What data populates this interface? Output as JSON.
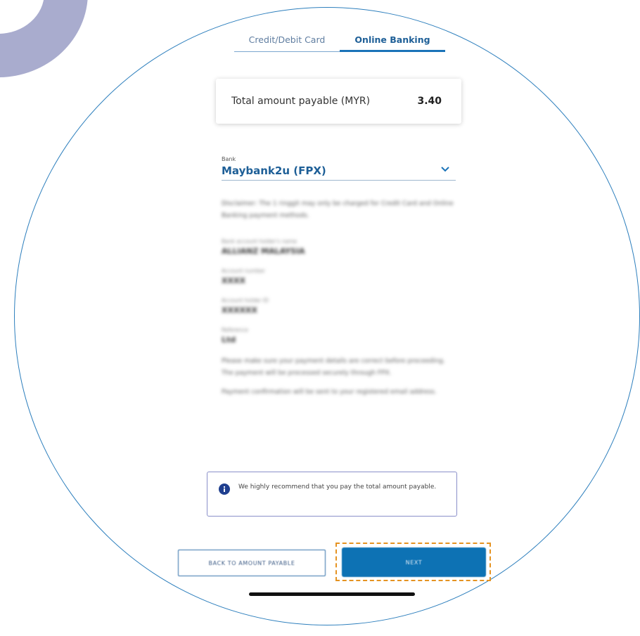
{
  "tabs": [
    {
      "label": "Credit/Debit Card",
      "active": false
    },
    {
      "label": "Online Banking",
      "active": true
    }
  ],
  "amount": {
    "label": "Total amount payable (MYR)",
    "value": "3.40"
  },
  "bank": {
    "caption": "Bank",
    "selected": "Maybank2u (FPX)"
  },
  "blurred_content": {
    "intro": "Disclaimer: The 1 ringgit may only be charged for Credit Card and Online Banking payment methods.",
    "fields": [
      {
        "label": "Bank account holder's name",
        "value": "ALLIANZ MALAYSIA"
      },
      {
        "label": "Account number",
        "value": "XXXX"
      },
      {
        "label": "Account holder ID",
        "value": "XXXXXX"
      },
      {
        "label": "Reference",
        "value": "Ltd"
      }
    ],
    "para1": "Please make sure your payment details are correct before proceeding. The payment will be processed securely through FPX.",
    "para2": "Payment confirmation will be sent to your registered email address."
  },
  "notice": {
    "icon": "info-icon",
    "text": "We highly recommend that you pay the total amount payable."
  },
  "buttons": {
    "back": "BACK TO AMOUNT PAYABLE",
    "next": "NEXT"
  },
  "colors": {
    "accent": "#1a73b8",
    "primary_button": "#0d72b4",
    "highlight": "#e59321",
    "decor": "#a9acce"
  }
}
